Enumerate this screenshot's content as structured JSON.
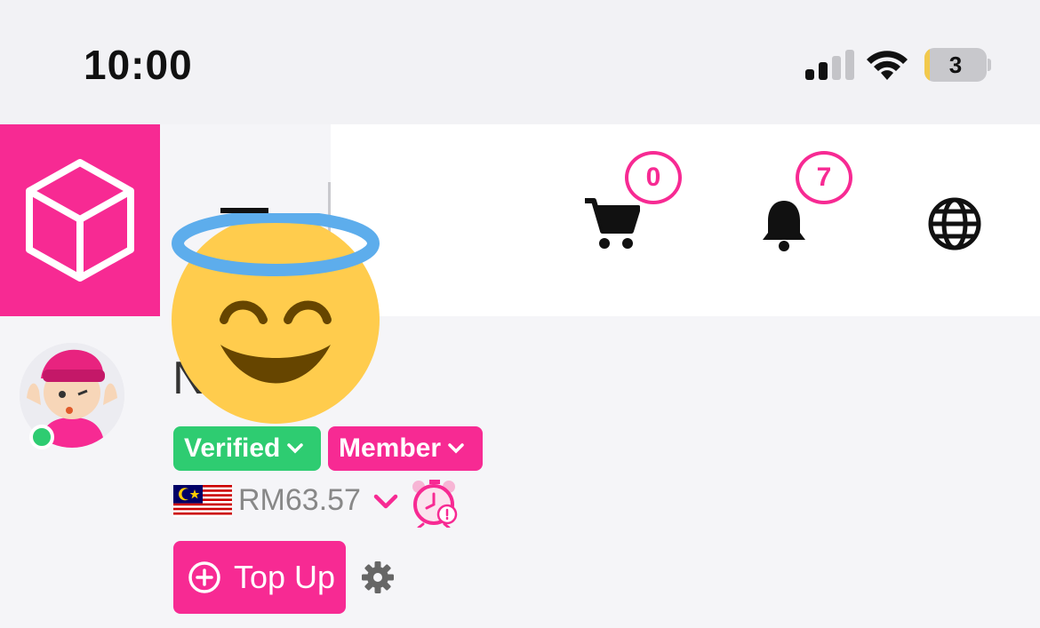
{
  "status_bar": {
    "time": "10:00",
    "battery_level": "3",
    "signal_bars_active": 2
  },
  "header": {
    "logo_icon": "box-icon",
    "cart": {
      "icon": "cart-icon",
      "count": "0"
    },
    "notifications": {
      "icon": "bell-icon",
      "count": "7"
    },
    "language": {
      "icon": "globe-icon"
    }
  },
  "profile": {
    "name": "N          d",
    "status": "online",
    "tags": {
      "verified": "Verified",
      "member": "Member"
    },
    "wallet": {
      "flag": "malaysia-flag",
      "balance": "RM63.57"
    },
    "topup_label": "Top Up"
  },
  "colors": {
    "brand_pink": "#f72a93",
    "verified_green": "#2ecc71",
    "online_green": "#2ecc71"
  }
}
